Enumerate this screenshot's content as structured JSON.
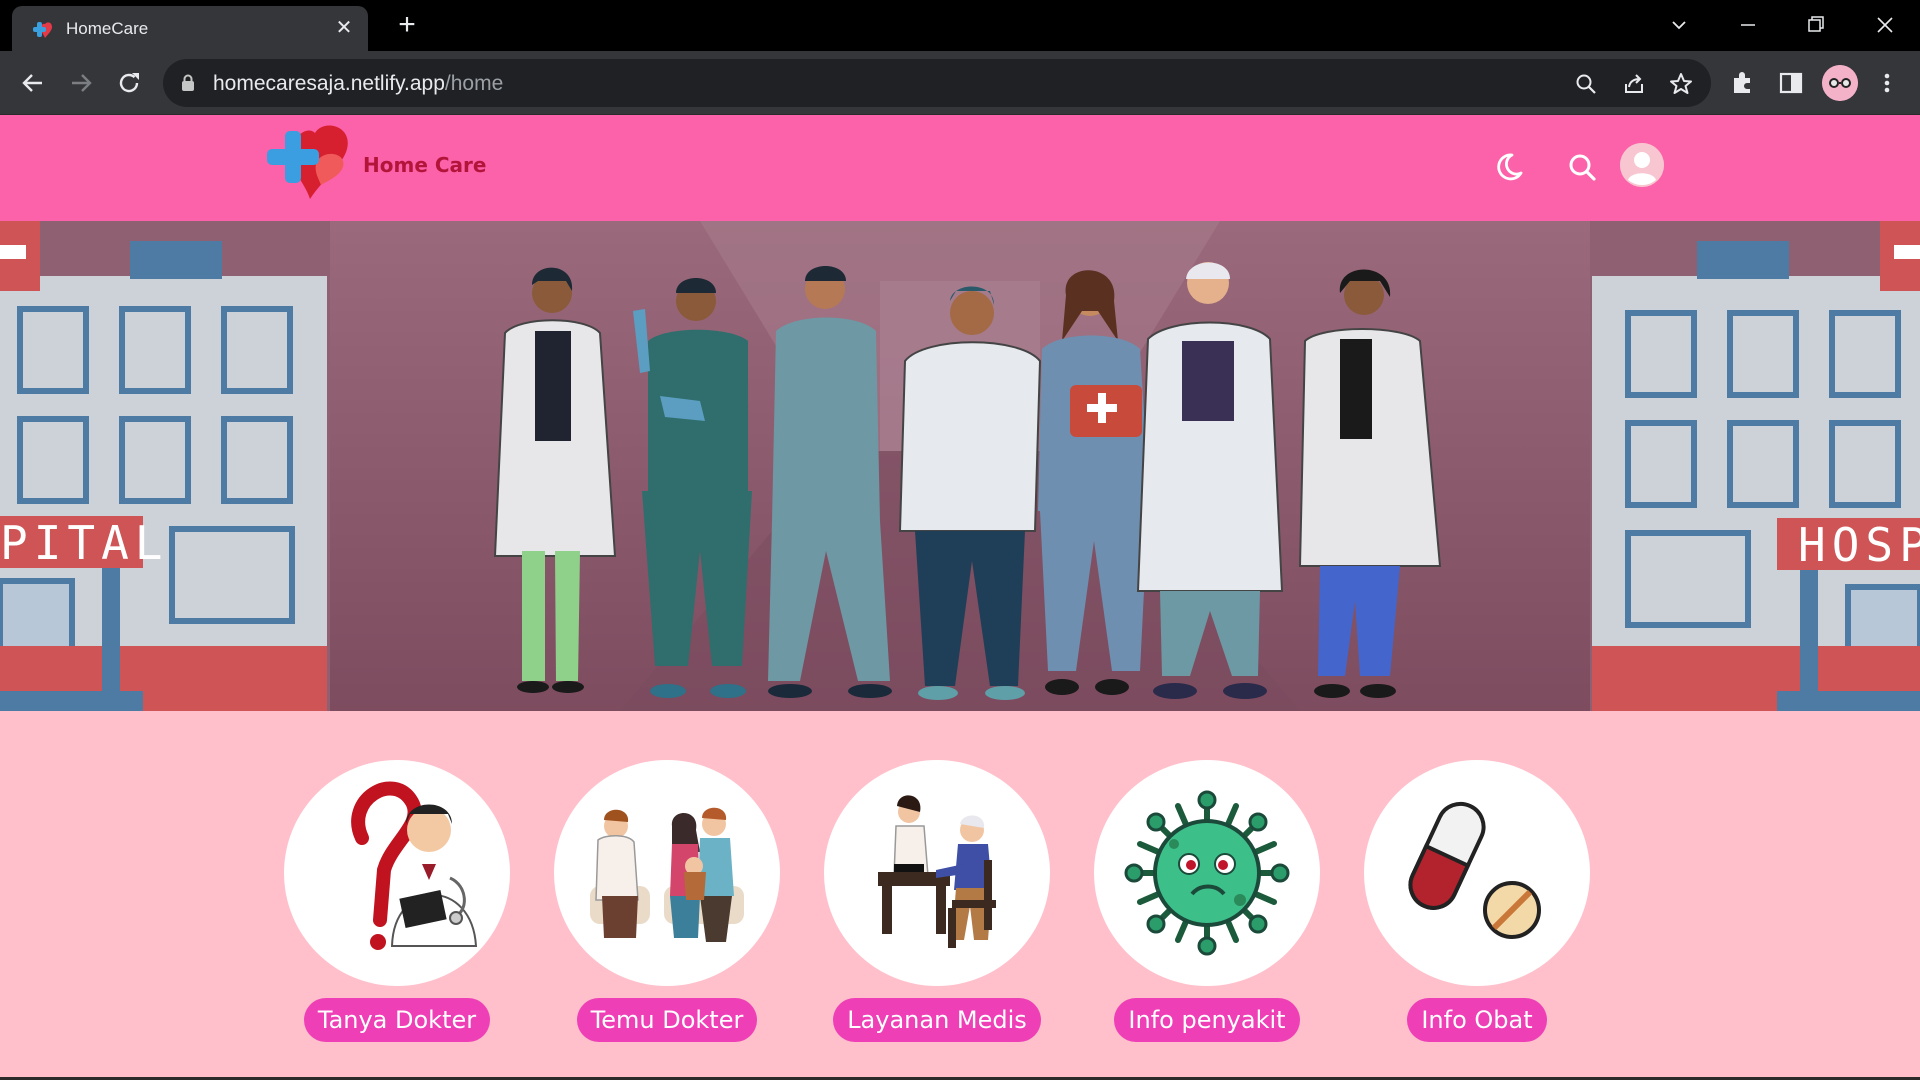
{
  "browser": {
    "tab_title": "HomeCare",
    "url_host": "homecaresaja.netlify.app",
    "url_path": "/home"
  },
  "site": {
    "brand": "Home Care",
    "brand_color": "#b3153a",
    "header_color": "#fc62a9",
    "page_bg": "#ffc0cb",
    "button_color": "#ee3fb7",
    "header_icons": [
      "moon-icon",
      "search-icon",
      "user-avatar-icon"
    ]
  },
  "hero": {
    "left_sign": "PITAL",
    "right_sign": "HOSP"
  },
  "services": [
    {
      "label": "Tanya Dokter",
      "icon": "doctor-question-icon"
    },
    {
      "label": "Temu Dokter",
      "icon": "doctor-meeting-icon"
    },
    {
      "label": "Layanan Medis",
      "icon": "medical-service-icon"
    },
    {
      "label": "Info penyakit",
      "icon": "virus-icon"
    },
    {
      "label": "Info Obat",
      "icon": "pill-icon"
    }
  ]
}
